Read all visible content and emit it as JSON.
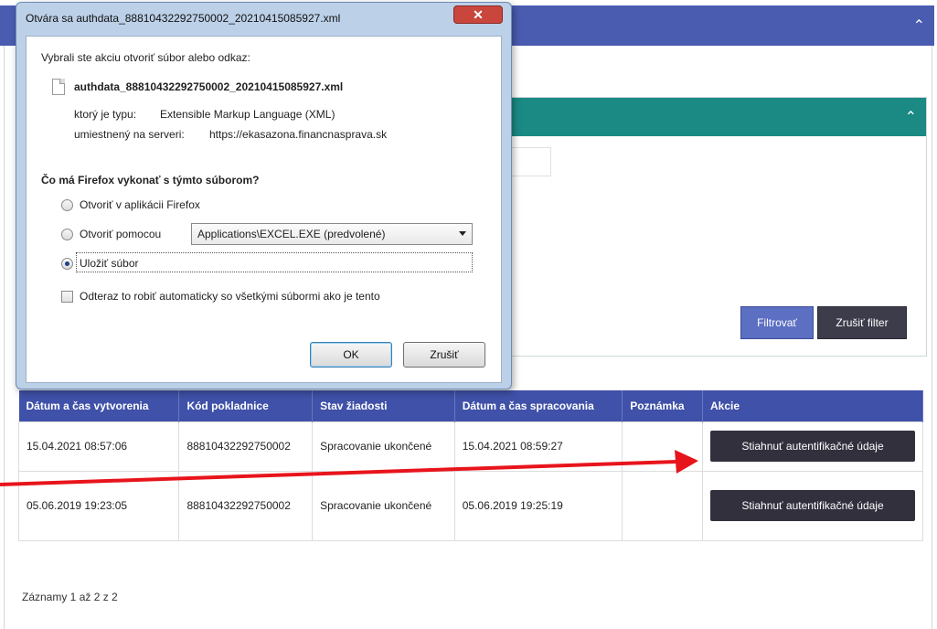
{
  "dialog": {
    "title": "Otvára sa authdata_88810432292750002_20210415085927.xml",
    "close_symbol": "✕",
    "intro": "Vybrali ste akciu otvoriť súbor alebo odkaz:",
    "file_name": "authdata_88810432292750002_20210415085927.xml",
    "type_label": "ktorý je typu:",
    "type_value": "Extensible Markup Language (XML)",
    "server_label": "umiestnený na serveri:",
    "server_value": "https://ekasazona.financnasprava.sk",
    "question": "Čo má Firefox vykonať s týmto súborom?",
    "option_open_firefox": "Otvoriť v aplikácii Firefox",
    "option_open_with": "Otvoriť pomocou",
    "open_with_app": "Applications\\EXCEL.EXE (predvolené)",
    "option_save": "Uložiť súbor",
    "selected_option": "save",
    "auto_checkbox": "Odteraz to robiť automaticky so všetkými súbormi ako je tento",
    "auto_checked": false,
    "ok_label": "OK",
    "cancel_label": "Zrušiť"
  },
  "filter": {
    "filter_button": "Filtrovať",
    "clear_button": "Zrušiť filter"
  },
  "table": {
    "headers": [
      "Dátum a čas vytvorenia",
      "Kód pokladnice",
      "Stav žiadosti",
      "Dátum a čas spracovania",
      "Poznámka",
      "Akcie"
    ],
    "rows": [
      {
        "created": "15.04.2021 08:57:06",
        "code": "88810432292750002",
        "status": "Spracovanie ukončené",
        "processed": "15.04.2021 08:59:27",
        "note": "",
        "action": "Stiahnuť autentifikačné údaje"
      },
      {
        "created": "05.06.2019 19:23:05",
        "code": "88810432292750002",
        "status": "Spracovanie ukončené",
        "processed": "05.06.2019 19:25:19",
        "note": "",
        "action": "Stiahnuť autentifikačné údaje"
      }
    ]
  },
  "records_info": "Záznamy 1 až 2 z 2",
  "icons": {
    "collapse": "chevron-up-icon",
    "file": "file-icon"
  },
  "colors": {
    "top_bar": "#4a5cb0",
    "filter_header": "#1b8a84",
    "table_header": "#3f51a8",
    "action_button": "#33303e",
    "arrow": "#e8141c"
  }
}
